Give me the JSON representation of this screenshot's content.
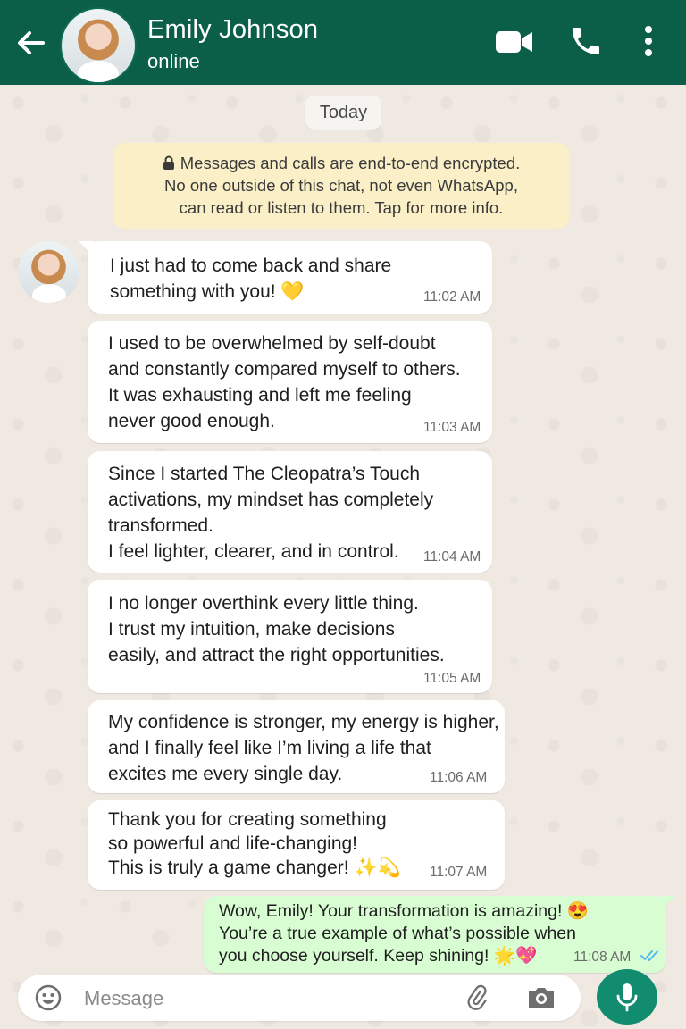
{
  "header": {
    "contact_name": "Emily Johnson",
    "status": "online",
    "colors": {
      "bar": "#0b5f48",
      "text": "#ffffff"
    },
    "icons": [
      "back-arrow-icon",
      "video-call-icon",
      "voice-call-icon",
      "more-vert-icon"
    ]
  },
  "date_label": "Today",
  "encryption_notice": {
    "line1": "Messages and calls are end-to-end encrypted.",
    "line2": "No one outside of this chat, not even WhatsApp,",
    "line3": "can read or listen to them. Tap for more info."
  },
  "messages": [
    {
      "direction": "incoming",
      "text": "I just had to come back and share\nsomething with you! 💛",
      "time": "11:02 AM"
    },
    {
      "direction": "incoming",
      "text": "I used to be overwhelmed by self-doubt\nand constantly compared myself to others.\nIt was exhausting and left me feeling\nnever good enough.",
      "time": "11:03 AM"
    },
    {
      "direction": "incoming",
      "text": "Since I started The Cleopatra’s Touch\nactivations, my mindset has completely\ntransformed.\nI feel lighter, clearer, and in control.",
      "time": "11:04 AM"
    },
    {
      "direction": "incoming",
      "text": "I no longer overthink every little thing.\nI trust my intuition, make decisions\neasily, and attract the right opportunities.",
      "time": "11:05 AM"
    },
    {
      "direction": "incoming",
      "text": "My confidence is stronger, my energy is higher,\nand I finally feel like I’m living a life that\nexcites me every single day.",
      "time": "11:06 AM"
    },
    {
      "direction": "incoming",
      "text": "Thank you for creating something\nso powerful and life-changing!\nThis is truly a game changer! ✨💫",
      "time": "11:07 AM"
    },
    {
      "direction": "outgoing",
      "text": "Wow, Emily! Your transformation is amazing! 😍\nYou’re a true example of what’s possible when\nyou choose yourself. Keep shining! 🌟💖",
      "time": "11:08 AM",
      "status": "read"
    }
  ],
  "composer": {
    "placeholder": "Message",
    "icons": [
      "emoji-icon",
      "attach-icon",
      "camera-icon",
      "mic-icon"
    ]
  },
  "colors": {
    "incoming_bubble": "#ffffff",
    "outgoing_bubble": "#d9fdd3",
    "mic_button": "#128c6e",
    "read_ticks": "#53bdeb"
  }
}
